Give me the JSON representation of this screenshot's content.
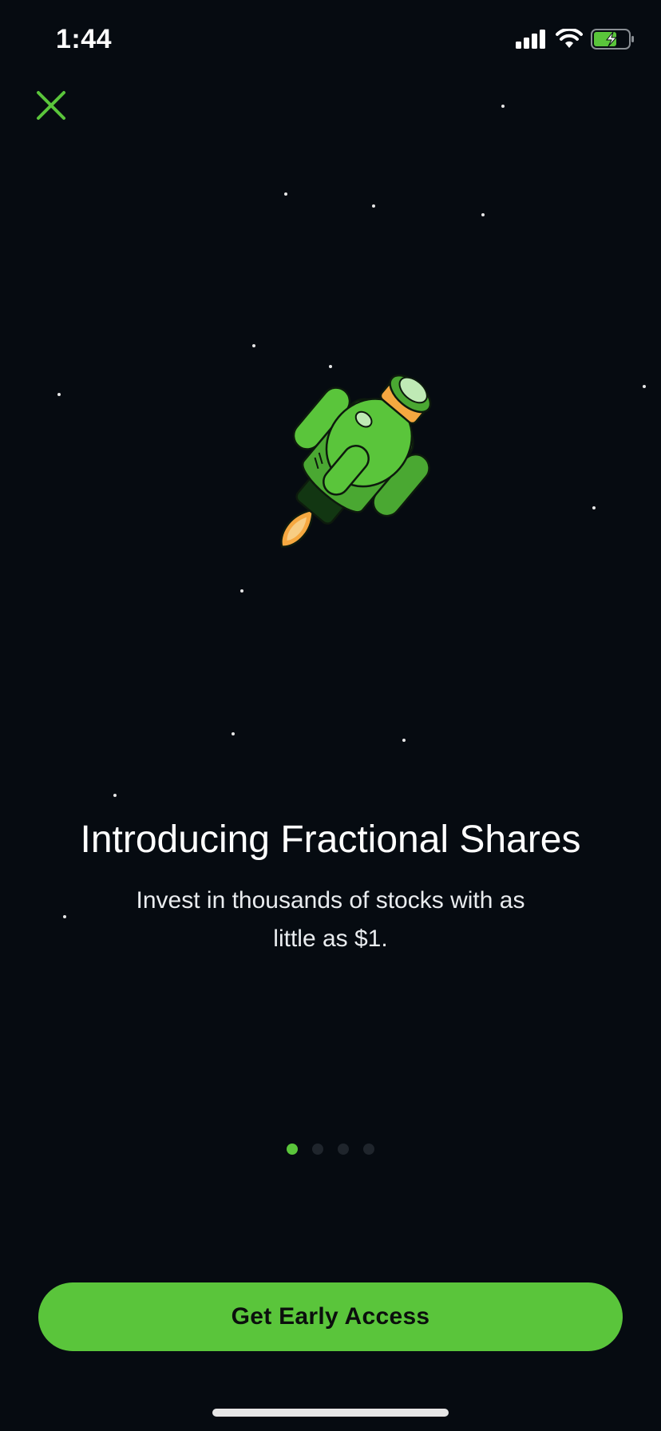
{
  "status_bar": {
    "time": "1:44",
    "icons": [
      "signal-icon",
      "wifi-icon",
      "battery-charging-icon"
    ]
  },
  "close_icon": "close-icon",
  "illustration": "rocket-icon",
  "onboarding": {
    "title": "Introducing Fractional Shares",
    "subtitle": "Invest in thousands of stocks with as little as $1.",
    "page_count": 4,
    "active_page": 1
  },
  "cta": {
    "label": "Get Early Access"
  },
  "colors": {
    "background": "#060b11",
    "accent": "#5ac53b",
    "text": "#ffffff",
    "dot_inactive": "#1f252c"
  }
}
